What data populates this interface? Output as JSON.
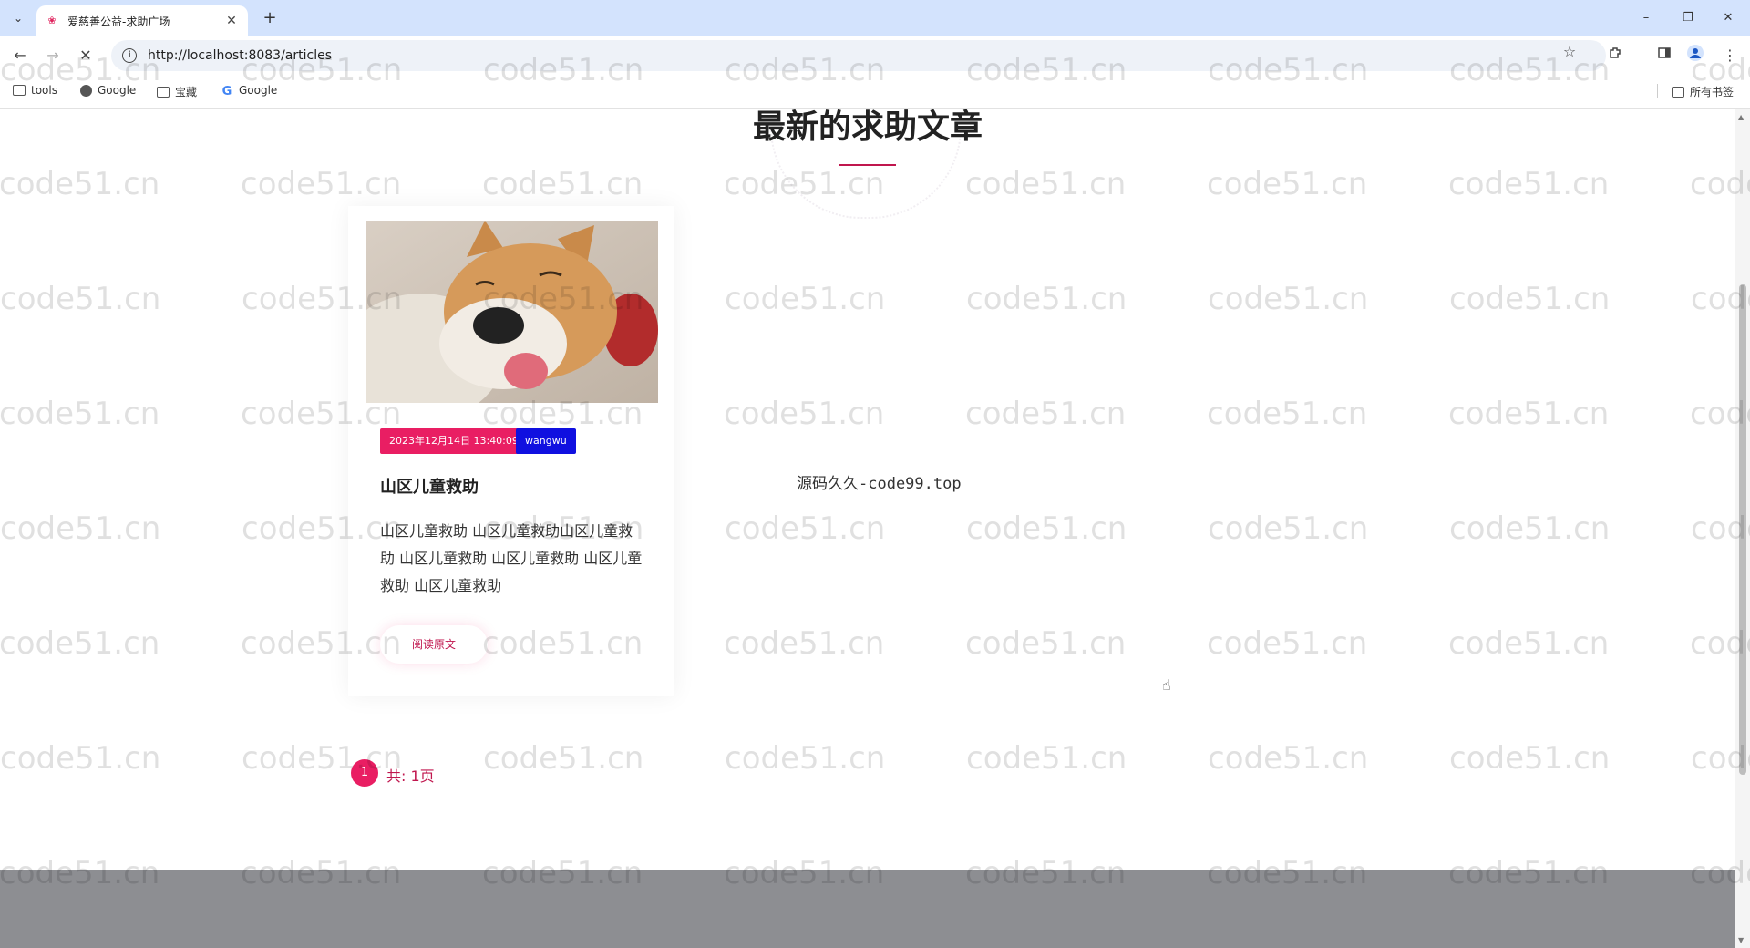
{
  "browser": {
    "tab_title": "爱慈善公益-求助广场",
    "url": "http://localhost:8083/articles",
    "bookmarks": [
      "tools",
      "Google",
      "宝藏",
      "Google"
    ],
    "all_bookmarks": "所有书签",
    "win_min": "–",
    "win_restore": "❐",
    "win_close": "✕",
    "tab_close": "✕",
    "new_tab": "+",
    "tab_search": "⌄",
    "back": "←",
    "forward": "→",
    "stop": "✕",
    "star": "☆",
    "info": "i"
  },
  "page": {
    "section_title": "最新的求助文章",
    "center_text": "源码久久-code99.top",
    "card": {
      "date_badge": "2023年12月14日 13:40:09",
      "user_badge": "wangwu",
      "title": "山区儿童救助",
      "excerpt": "山区儿童救助 山区儿童救助山区儿童救助 山区儿童救助 山区儿童救助 山区儿童救助 山区儿童救助",
      "read_button": "阅读原文"
    },
    "pagination": {
      "current": "1",
      "total_label": "共: 1页"
    }
  },
  "watermark": "code51.cn",
  "colors": {
    "accent": "#e91e63",
    "user_badge": "#1010e0",
    "footer": "#8d8e92"
  }
}
